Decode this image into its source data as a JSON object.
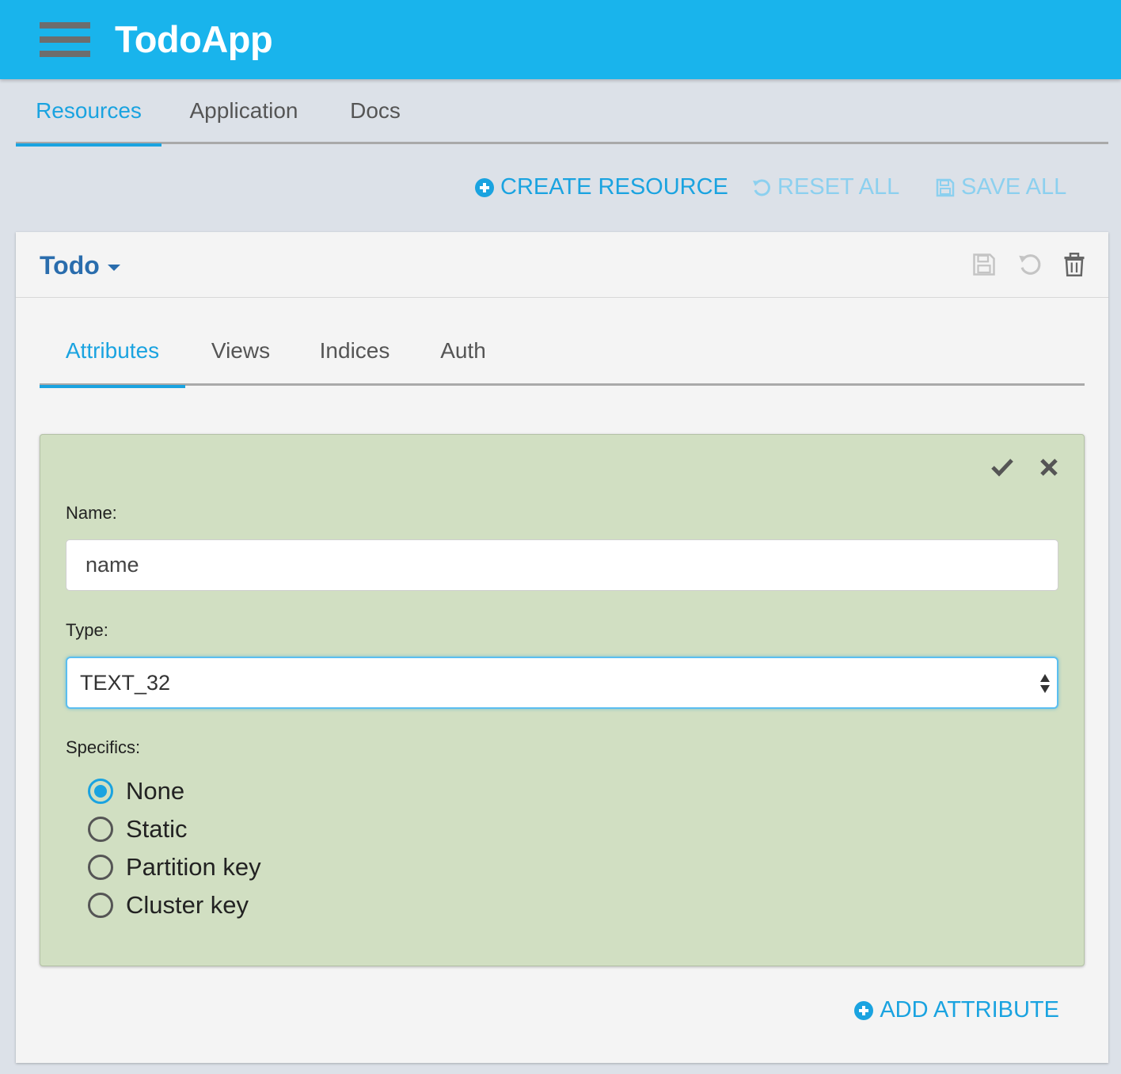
{
  "app": {
    "title": "TodoApp"
  },
  "main_tabs": [
    {
      "label": "Resources",
      "active": true
    },
    {
      "label": "Application",
      "active": false
    },
    {
      "label": "Docs",
      "active": false
    }
  ],
  "actions": {
    "create": "CREATE RESOURCE",
    "reset": "RESET ALL",
    "save": "SAVE ALL"
  },
  "resource": {
    "name": "Todo",
    "tabs": [
      {
        "label": "Attributes",
        "active": true
      },
      {
        "label": "Views",
        "active": false
      },
      {
        "label": "Indices",
        "active": false
      },
      {
        "label": "Auth",
        "active": false
      }
    ],
    "attribute_form": {
      "name_label": "Name:",
      "name_value": "name",
      "type_label": "Type:",
      "type_value": "TEXT_32",
      "specifics_label": "Specifics:",
      "specifics": [
        {
          "label": "None",
          "checked": true
        },
        {
          "label": "Static",
          "checked": false
        },
        {
          "label": "Partition key",
          "checked": false
        },
        {
          "label": "Cluster key",
          "checked": false
        }
      ]
    },
    "add_attribute": "ADD ATTRIBUTE"
  },
  "colors": {
    "appbar": "#19b4ec",
    "accent": "#1aa3e0",
    "resource_title": "#2a6dad",
    "panel_bg": "#d1dfc2",
    "page_bg": "#dce1e8"
  },
  "icons": {
    "menu": "hamburger-icon",
    "create": "plus-circle-icon",
    "reset": "undo-icon",
    "save": "floppy-disk-icon",
    "delete": "trash-icon",
    "confirm": "check-icon",
    "cancel": "close-icon"
  }
}
